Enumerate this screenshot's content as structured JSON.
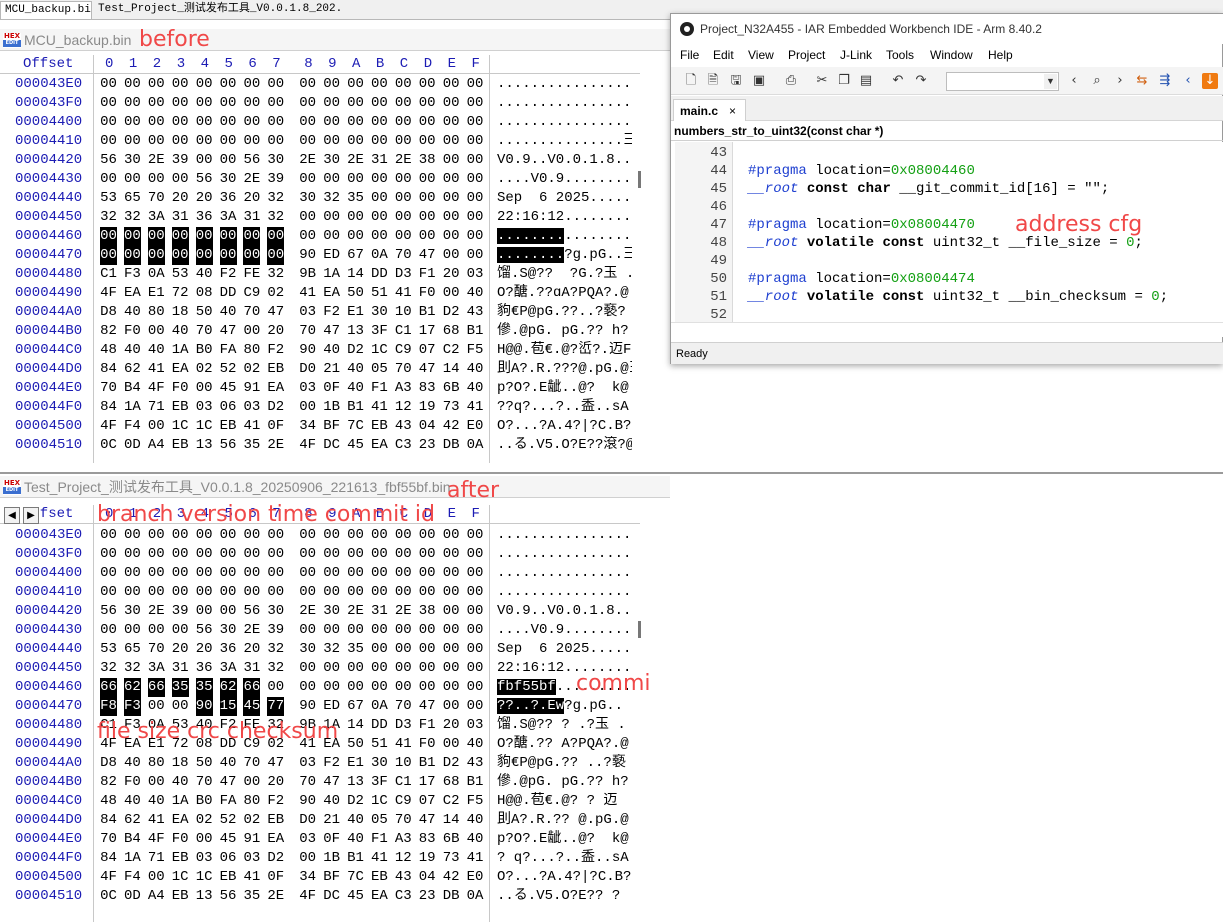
{
  "file_tabs": [
    "MCU_backup.bin",
    "Test_Project_测试发布工具_V0.0.1.8_202..."
  ],
  "hex_header": {
    "offset_label": "Offset",
    "columns": [
      "0",
      "1",
      "2",
      "3",
      "4",
      "5",
      "6",
      "7",
      "8",
      "9",
      "A",
      "B",
      "C",
      "D",
      "E",
      "F"
    ]
  },
  "pane_top": {
    "logo_text": "HEX",
    "logo_subtext": "EDIT",
    "title": "MCU_backup.bin",
    "annotations": [
      "before"
    ],
    "rows": [
      {
        "offset": "000043E0",
        "bytes": [
          "00",
          "00",
          "00",
          "00",
          "00",
          "00",
          "00",
          "00",
          "00",
          "00",
          "00",
          "00",
          "00",
          "00",
          "00",
          "00"
        ],
        "ascii": "................?"
      },
      {
        "offset": "000043F0",
        "bytes": [
          "00",
          "00",
          "00",
          "00",
          "00",
          "00",
          "00",
          "00",
          "00",
          "00",
          "00",
          "00",
          "00",
          "00",
          "00",
          "00"
        ],
        "ascii": "................|"
      },
      {
        "offset": "00004400",
        "bytes": [
          "00",
          "00",
          "00",
          "00",
          "00",
          "00",
          "00",
          "00",
          "00",
          "00",
          "00",
          "00",
          "00",
          "00",
          "00",
          "00"
        ],
        "ascii": "................"
      },
      {
        "offset": "00004410",
        "bytes": [
          "00",
          "00",
          "00",
          "00",
          "00",
          "00",
          "00",
          "00",
          "00",
          "00",
          "00",
          "00",
          "00",
          "00",
          "00",
          "00"
        ],
        "ascii": "...............彐"
      },
      {
        "offset": "00004420",
        "bytes": [
          "56",
          "30",
          "2E",
          "39",
          "00",
          "00",
          "56",
          "30",
          "2E",
          "30",
          "2E",
          "31",
          "2E",
          "38",
          "00",
          "00"
        ],
        "ascii": "V0.9..V0.0.1.8..?"
      },
      {
        "offset": "00004430",
        "bytes": [
          "00",
          "00",
          "00",
          "00",
          "56",
          "30",
          "2E",
          "39",
          "00",
          "00",
          "00",
          "00",
          "00",
          "00",
          "00",
          "00"
        ],
        "ascii": "....V0.9........"
      },
      {
        "offset": "00004440",
        "bytes": [
          "53",
          "65",
          "70",
          "20",
          "20",
          "36",
          "20",
          "32",
          "30",
          "32",
          "35",
          "00",
          "00",
          "00",
          "00",
          "00"
        ],
        "ascii": "Sep  6 2025.....?"
      },
      {
        "offset": "00004450",
        "bytes": [
          "32",
          "32",
          "3A",
          "31",
          "36",
          "3A",
          "31",
          "32",
          "00",
          "00",
          "00",
          "00",
          "00",
          "00",
          "00",
          "00"
        ],
        "ascii": "22:16:12........?"
      },
      {
        "offset": "00004460",
        "bytes": [
          "00",
          "00",
          "00",
          "00",
          "00",
          "00",
          "00",
          "00",
          "00",
          "00",
          "00",
          "00",
          "00",
          "00",
          "00",
          "00"
        ],
        "ascii": "................",
        "sel": [
          0,
          1,
          2,
          3,
          4,
          5,
          6,
          7
        ],
        "asc_sel": "........",
        "asc_rest": "........"
      },
      {
        "offset": "00004470",
        "bytes": [
          "00",
          "00",
          "00",
          "00",
          "00",
          "00",
          "00",
          "00",
          "90",
          "ED",
          "67",
          "0A",
          "70",
          "47",
          "00",
          "00"
        ],
        "ascii": "........?g.pG..彐",
        "sel": [
          0,
          1,
          2,
          3,
          4,
          5,
          6,
          7
        ],
        "asc_sel": "........",
        "asc_rest": "?g.pG..彐"
      },
      {
        "offset": "00004480",
        "bytes": [
          "C1",
          "F3",
          "0A",
          "53",
          "40",
          "F2",
          "FE",
          "32",
          "9B",
          "1A",
          "14",
          "DD",
          "D3",
          "F1",
          "20",
          "03"
        ],
        "ascii": "馏.S@??  ?G.?玉 .?"
      },
      {
        "offset": "00004490",
        "bytes": [
          "4F",
          "EA",
          "E1",
          "72",
          "08",
          "DD",
          "C9",
          "02",
          "41",
          "EA",
          "50",
          "51",
          "41",
          "F0",
          "00",
          "40"
        ],
        "ascii": "O?醣.??ɑA?PQA?.@"
      },
      {
        "offset": "000044A0",
        "bytes": [
          "D8",
          "40",
          "80",
          "18",
          "50",
          "40",
          "70",
          "47",
          "03",
          "F2",
          "E1",
          "30",
          "10",
          "B1",
          "D2",
          "43"
        ],
        "ascii": "豿€P@pG.??..?褻?"
      },
      {
        "offset": "000044B0",
        "bytes": [
          "82",
          "F0",
          "00",
          "40",
          "70",
          "47",
          "00",
          "20",
          "70",
          "47",
          "13",
          "3F",
          "C1",
          "17",
          "68",
          "B1"
        ],
        "ascii": "傪.@pG. pG.?? h?|"
      },
      {
        "offset": "000044C0",
        "bytes": [
          "48",
          "40",
          "40",
          "1A",
          "B0",
          "FA",
          "80",
          "F2",
          "90",
          "40",
          "D2",
          "1C",
          "C9",
          "07",
          "C2",
          "F5"
        ],
        "ascii": "H@@.苞€.@?峾?.迈F"
      },
      {
        "offset": "000044D0",
        "bytes": [
          "84",
          "62",
          "41",
          "EA",
          "02",
          "52",
          "02",
          "EB",
          "D0",
          "21",
          "40",
          "05",
          "70",
          "47",
          "14",
          "40"
        ],
        "ascii": "刞A?.R.???@.pG.@彐"
      },
      {
        "offset": "000044E0",
        "bytes": [
          "70",
          "B4",
          "4F",
          "F0",
          "00",
          "45",
          "91",
          "EA",
          "03",
          "0F",
          "40",
          "F1",
          "A3",
          "83",
          "6B",
          "40"
        ],
        "ascii": "p?O?.E龇..@?  k@"
      },
      {
        "offset": "000044F0",
        "bytes": [
          "84",
          "1A",
          "71",
          "EB",
          "03",
          "06",
          "03",
          "D2",
          "00",
          "1B",
          "B1",
          "41",
          "12",
          "19",
          "73",
          "41"
        ],
        "ascii": "??q?...?..盉..sA"
      },
      {
        "offset": "00004500",
        "bytes": [
          "4F",
          "F4",
          "00",
          "1C",
          "1C",
          "EB",
          "41",
          "0F",
          "34",
          "BF",
          "7C",
          "EB",
          "43",
          "04",
          "42",
          "E0"
        ],
        "ascii": "O?...?A.4?|?C.B?"
      },
      {
        "offset": "00004510",
        "bytes": [
          "0C",
          "0D",
          "A4",
          "EB",
          "13",
          "56",
          "35",
          "2E",
          "4F",
          "DC",
          "45",
          "EA",
          "C3",
          "23",
          "DB",
          "0A"
        ],
        "ascii": "..る.V5.O?E??滾?@|"
      }
    ]
  },
  "pane_bottom": {
    "logo_text": "HEX",
    "logo_subtext": "EDIT",
    "title": "Test_Project_测试发布工具_V0.0.1.8_20250906_221613_fbf55bf.bin",
    "annotations": [
      "after",
      "branch  version   time   commit id",
      "commit id",
      "file size   crc checksum"
    ],
    "rows": [
      {
        "offset": "000043E0",
        "bytes": [
          "00",
          "00",
          "00",
          "00",
          "00",
          "00",
          "00",
          "00",
          "00",
          "00",
          "00",
          "00",
          "00",
          "00",
          "00",
          "00"
        ],
        "ascii": "................"
      },
      {
        "offset": "000043F0",
        "bytes": [
          "00",
          "00",
          "00",
          "00",
          "00",
          "00",
          "00",
          "00",
          "00",
          "00",
          "00",
          "00",
          "00",
          "00",
          "00",
          "00"
        ],
        "ascii": "................"
      },
      {
        "offset": "00004400",
        "bytes": [
          "00",
          "00",
          "00",
          "00",
          "00",
          "00",
          "00",
          "00",
          "00",
          "00",
          "00",
          "00",
          "00",
          "00",
          "00",
          "00"
        ],
        "ascii": "................"
      },
      {
        "offset": "00004410",
        "bytes": [
          "00",
          "00",
          "00",
          "00",
          "00",
          "00",
          "00",
          "00",
          "00",
          "00",
          "00",
          "00",
          "00",
          "00",
          "00",
          "00"
        ],
        "ascii": "................"
      },
      {
        "offset": "00004420",
        "bytes": [
          "56",
          "30",
          "2E",
          "39",
          "00",
          "00",
          "56",
          "30",
          "2E",
          "30",
          "2E",
          "31",
          "2E",
          "38",
          "00",
          "00"
        ],
        "ascii": "V0.9..V0.0.1.8.."
      },
      {
        "offset": "00004430",
        "bytes": [
          "00",
          "00",
          "00",
          "00",
          "56",
          "30",
          "2E",
          "39",
          "00",
          "00",
          "00",
          "00",
          "00",
          "00",
          "00",
          "00"
        ],
        "ascii": "....V0.9........"
      },
      {
        "offset": "00004440",
        "bytes": [
          "53",
          "65",
          "70",
          "20",
          "20",
          "36",
          "20",
          "32",
          "30",
          "32",
          "35",
          "00",
          "00",
          "00",
          "00",
          "00"
        ],
        "ascii": "Sep  6 2025....."
      },
      {
        "offset": "00004450",
        "bytes": [
          "32",
          "32",
          "3A",
          "31",
          "36",
          "3A",
          "31",
          "32",
          "00",
          "00",
          "00",
          "00",
          "00",
          "00",
          "00",
          "00"
        ],
        "ascii": "22:16:12........"
      },
      {
        "offset": "00004460",
        "bytes": [
          "66",
          "62",
          "66",
          "35",
          "35",
          "62",
          "66",
          "00",
          "00",
          "00",
          "00",
          "00",
          "00",
          "00",
          "00",
          "00"
        ],
        "ascii": "fbf55bf.........",
        "sel": [
          0,
          1,
          2,
          3,
          4,
          5,
          6
        ],
        "asc_sel": "fbf55bf",
        "asc_rest": "........."
      },
      {
        "offset": "00004470",
        "bytes": [
          "F8",
          "F3",
          "00",
          "00",
          "90",
          "15",
          "45",
          "77",
          "90",
          "ED",
          "67",
          "0A",
          "70",
          "47",
          "00",
          "00"
        ],
        "ascii": "??..?.Ew.?g.pG..",
        "sel": [
          0,
          1,
          4,
          5,
          6,
          7
        ],
        "asc_sel": "??..?.Ew",
        "asc_rest": "?g.pG.."
      },
      {
        "offset": "00004480",
        "bytes": [
          "C1",
          "F3",
          "0A",
          "53",
          "40",
          "F2",
          "FE",
          "32",
          "9B",
          "1A",
          "14",
          "DD",
          "D3",
          "F1",
          "20",
          "03"
        ],
        "ascii": "馏.S@?? ? .?玉 ."
      },
      {
        "offset": "00004490",
        "bytes": [
          "4F",
          "EA",
          "E1",
          "72",
          "08",
          "DD",
          "C9",
          "02",
          "41",
          "EA",
          "50",
          "51",
          "41",
          "F0",
          "00",
          "40"
        ],
        "ascii": "O?醣.?? A?PQA?.@"
      },
      {
        "offset": "000044A0",
        "bytes": [
          "D8",
          "40",
          "80",
          "18",
          "50",
          "40",
          "70",
          "47",
          "03",
          "F2",
          "E1",
          "30",
          "10",
          "B1",
          "D2",
          "43"
        ],
        "ascii": "豿€P@pG.?? ..?褻"
      },
      {
        "offset": "000044B0",
        "bytes": [
          "82",
          "F0",
          "00",
          "40",
          "70",
          "47",
          "00",
          "20",
          "70",
          "47",
          "13",
          "3F",
          "C1",
          "17",
          "68",
          "B1"
        ],
        "ascii": "傪.@pG. pG.?? h?"
      },
      {
        "offset": "000044C0",
        "bytes": [
          "48",
          "40",
          "40",
          "1A",
          "B0",
          "FA",
          "80",
          "F2",
          "90",
          "40",
          "D2",
          "1C",
          "C9",
          "07",
          "C2",
          "F5"
        ],
        "ascii": "H@@.苞€.@? ? 迈"
      },
      {
        "offset": "000044D0",
        "bytes": [
          "84",
          "62",
          "41",
          "EA",
          "02",
          "52",
          "02",
          "EB",
          "D0",
          "21",
          "40",
          "05",
          "70",
          "47",
          "14",
          "40"
        ],
        "ascii": "刞A?.R.?? @.pG.@"
      },
      {
        "offset": "000044E0",
        "bytes": [
          "70",
          "B4",
          "4F",
          "F0",
          "00",
          "45",
          "91",
          "EA",
          "03",
          "0F",
          "40",
          "F1",
          "A3",
          "83",
          "6B",
          "40"
        ],
        "ascii": "p?O?.E龇..@?  k@"
      },
      {
        "offset": "000044F0",
        "bytes": [
          "84",
          "1A",
          "71",
          "EB",
          "03",
          "06",
          "03",
          "D2",
          "00",
          "1B",
          "B1",
          "41",
          "12",
          "19",
          "73",
          "41"
        ],
        "ascii": "? q?...?..盉..sA"
      },
      {
        "offset": "00004500",
        "bytes": [
          "4F",
          "F4",
          "00",
          "1C",
          "1C",
          "EB",
          "41",
          "0F",
          "34",
          "BF",
          "7C",
          "EB",
          "43",
          "04",
          "42",
          "E0"
        ],
        "ascii": "O?...?A.4?|?C.B?"
      },
      {
        "offset": "00004510",
        "bytes": [
          "0C",
          "0D",
          "A4",
          "EB",
          "13",
          "56",
          "35",
          "2E",
          "4F",
          "DC",
          "45",
          "EA",
          "C3",
          "23",
          "DB",
          "0A"
        ],
        "ascii": "..る.V5.O?E?? ?"
      }
    ]
  },
  "iar": {
    "title": "Project_N32A455 - IAR Embedded Workbench IDE - Arm 8.40.2",
    "menu": [
      "File",
      "Edit",
      "View",
      "Project",
      "J-Link",
      "Tools",
      "Window",
      "Help"
    ],
    "toolbar_icons": [
      "new-file-icon",
      "new-icon",
      "save-icon",
      "save-all-icon",
      "print-icon",
      "cut-icon",
      "copy-icon",
      "paste-icon",
      "undo-icon",
      "redo-icon",
      "nav-back-icon",
      "find-icon",
      "nav-forward-icon",
      "goto-icon",
      "bookmark-icon",
      "prev-icon",
      "download-icon"
    ],
    "doc_tab": "main.c",
    "doc_tab_close": "×",
    "function_context": "numbers_str_to_uint32(const char *)",
    "code_annotation": "address cfg",
    "lines": [
      {
        "n": "43",
        "segs": []
      },
      {
        "n": "44",
        "segs": [
          [
            "pp",
            "#pragma"
          ],
          [
            "t",
            " location="
          ],
          [
            "num",
            "0x08004460"
          ]
        ]
      },
      {
        "n": "45",
        "segs": [
          [
            "root",
            "__root"
          ],
          [
            "t",
            " "
          ],
          [
            "b",
            "const char"
          ],
          [
            "t",
            " __git_commit_id[16] = \"\";"
          ]
        ]
      },
      {
        "n": "46",
        "segs": []
      },
      {
        "n": "47",
        "segs": [
          [
            "pp",
            "#pragma"
          ],
          [
            "t",
            " location="
          ],
          [
            "num",
            "0x08004470"
          ]
        ]
      },
      {
        "n": "48",
        "segs": [
          [
            "root",
            "__root"
          ],
          [
            "t",
            " "
          ],
          [
            "b",
            "volatile const"
          ],
          [
            "t",
            " uint32_t __file_size = "
          ],
          [
            "num",
            "0"
          ],
          [
            "t",
            ";"
          ]
        ]
      },
      {
        "n": "49",
        "segs": []
      },
      {
        "n": "50",
        "segs": [
          [
            "pp",
            "#pragma"
          ],
          [
            "t",
            " location="
          ],
          [
            "num",
            "0x08004474"
          ]
        ]
      },
      {
        "n": "51",
        "segs": [
          [
            "root",
            "__root"
          ],
          [
            "t",
            " "
          ],
          [
            "b",
            "volatile const"
          ],
          [
            "t",
            " uint32_t __bin_checksum = "
          ],
          [
            "num",
            "0"
          ],
          [
            "t",
            ";"
          ]
        ]
      },
      {
        "n": "52",
        "segs": []
      }
    ],
    "status": "Ready"
  }
}
